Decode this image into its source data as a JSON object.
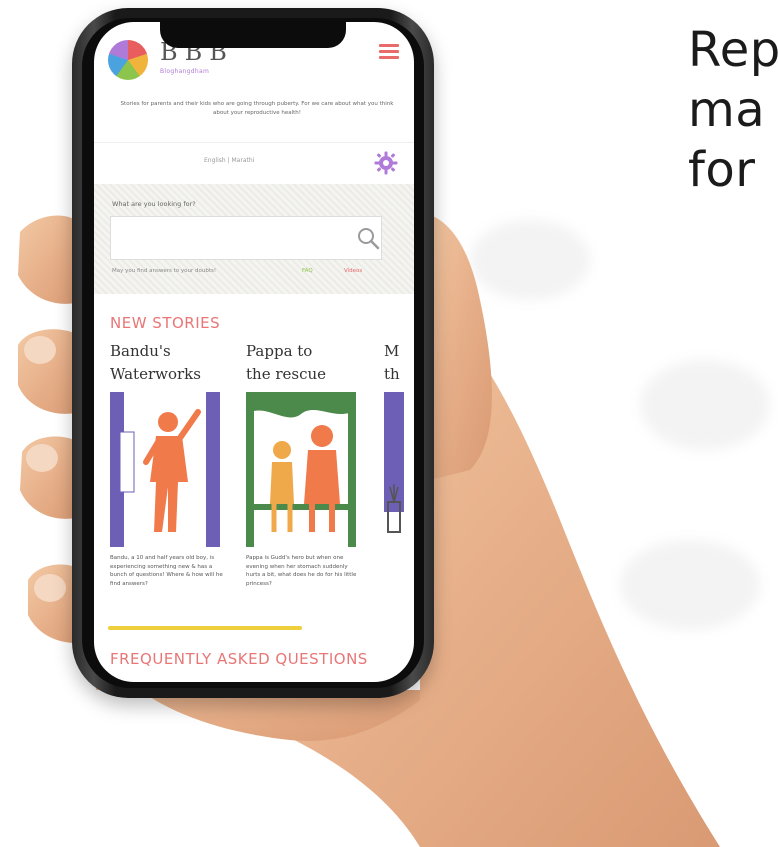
{
  "side_caption": "Rep\nma\nfor",
  "app": {
    "logo_text": "BBB",
    "logo_subtitle": "Bloghangdham",
    "tagline": "Stories for parents and their kids who are going through puberty. For we care about what you think about your reproductive health!",
    "language": "English  |  Marathi",
    "search": {
      "label": "What are you looking for?",
      "placeholder": "",
      "help": "May you find answers to your doubts!",
      "tag_faq": "FAQ",
      "tag_videos": "Videos"
    },
    "new_stories_title": "NEW STORIES",
    "stories": [
      {
        "title": "Bandu's\nWaterworks",
        "desc": "Bandu, a 10 and half years old boy, is experiencing something new & has a bunch of questions! Where & how will he find answers?"
      },
      {
        "title": "Pappa to\nthe rescue",
        "desc": "Pappa is Gudd's hero but when one evening when her stomach suddenly hurts a bit, what does he do for his little princess?"
      },
      {
        "title": "M\nth",
        "desc": ""
      }
    ],
    "faq_title": "FREQUENTLY ASKED QUESTIONS"
  },
  "colors": {
    "accent_coral": "#e87676",
    "scroll_yellow": "#f0cf3c",
    "gear_purple": "#b07ad8"
  }
}
